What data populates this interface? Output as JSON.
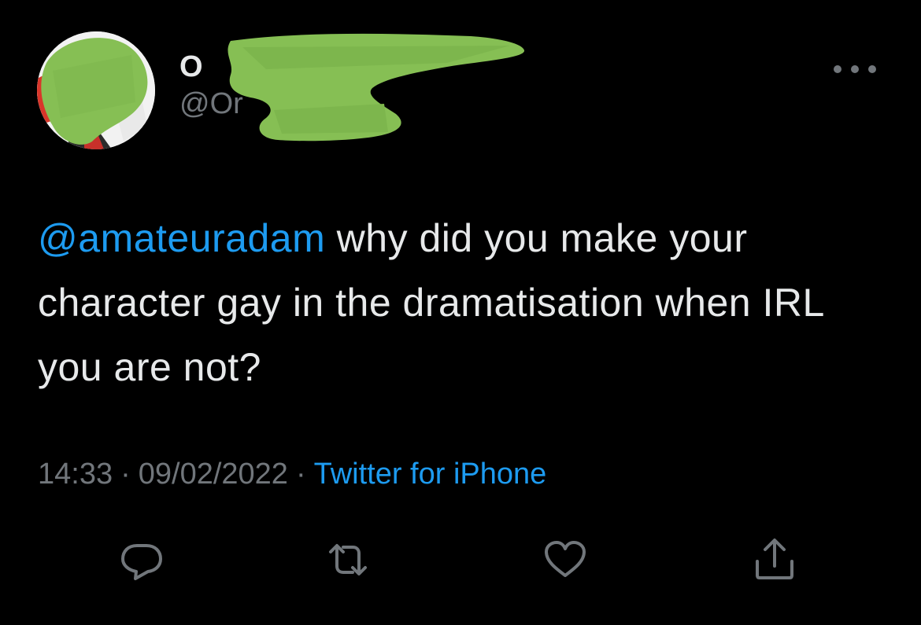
{
  "tweet": {
    "display_name": "O",
    "handle": "@Or",
    "mention": "@amateuradam",
    "text": " why did you make your character gay in the dramatisation when IRL you are not?",
    "time": "14:33",
    "date": "09/02/2022",
    "separator": "·",
    "source": "Twitter for iPhone"
  },
  "icons": {
    "more": "more-horizontal-icon",
    "reply": "reply-icon",
    "retweet": "retweet-icon",
    "like": "heart-icon",
    "share": "share-icon"
  },
  "colors": {
    "background": "#000000",
    "text": "#e7e9ea",
    "secondary": "#71767b",
    "accent": "#1d9bf0",
    "redaction": "#86bf54"
  }
}
